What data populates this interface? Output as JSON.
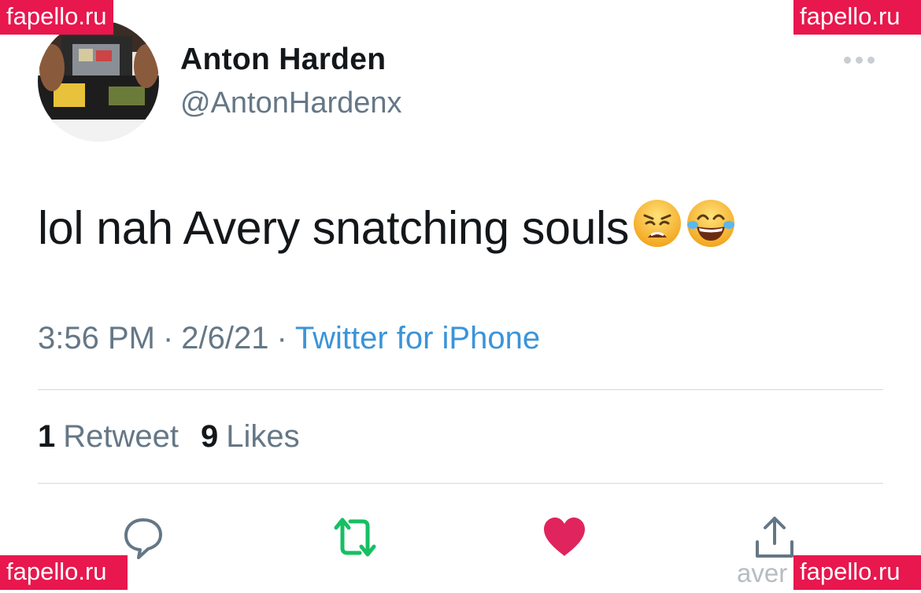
{
  "user": {
    "display_name": "Anton Harden",
    "handle": "@AntonHardenx"
  },
  "tweet": {
    "text": "lol nah Avery snatching souls",
    "emojis": [
      "weary-face-emoji",
      "face-with-tears-of-joy-emoji"
    ],
    "time": "3:56 PM",
    "date": "2/6/21",
    "separator": "·",
    "source": "Twitter for iPhone"
  },
  "stats": {
    "retweets_count": "1",
    "retweets_label": "Retweet",
    "likes_count": "9",
    "likes_label": "Likes"
  },
  "actions": {
    "reply_icon": "speech-bubble-icon",
    "retweet_icon": "retweet-icon",
    "like_icon": "heart-icon",
    "share_icon": "share-upload-icon",
    "retweet_color": "#17bf63",
    "like_color": "#e0245e",
    "reply_color": "#657786"
  },
  "watermarks": {
    "top_left": "fapello.ru",
    "top_right": "fapello.ru",
    "bottom_left": "fapello.ru",
    "bottom_right": "fapello.ru",
    "ghost_text": "aver"
  }
}
